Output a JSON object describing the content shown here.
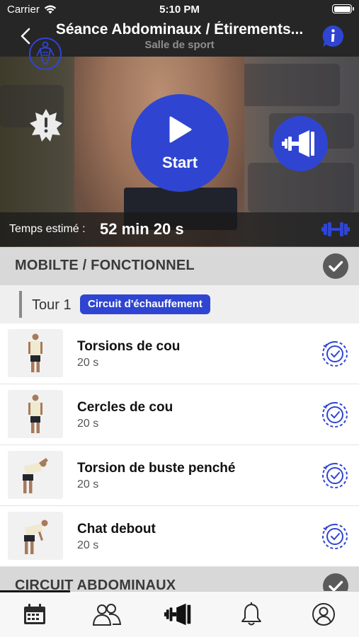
{
  "status_bar": {
    "carrier": "Carrier",
    "time": "5:10 PM"
  },
  "nav": {
    "title": "Séance Abdominaux / Étirements...",
    "subtitle": "Salle de sport"
  },
  "hero": {
    "start_label": "Start",
    "time_label": "Temps estimé :",
    "time_value": "52 min 20 s"
  },
  "sections": [
    {
      "title": "MOBILTE / FONCTIONNEL"
    },
    {
      "title": "CIRCUIT ABDOMINAUX"
    }
  ],
  "round": {
    "label": "Tour 1",
    "badge": "Circuit d'échauffement"
  },
  "exercises": [
    {
      "name": "Torsions de cou",
      "duration": "20 s"
    },
    {
      "name": "Cercles de cou",
      "duration": "20 s"
    },
    {
      "name": "Torsion de buste penché",
      "duration": "20 s"
    },
    {
      "name": "Chat debout",
      "duration": "20 s"
    }
  ],
  "tabs": [
    {
      "icon": "calendar-icon"
    },
    {
      "icon": "community-icon"
    },
    {
      "icon": "workout-icon"
    },
    {
      "icon": "bell-icon"
    },
    {
      "icon": "profile-icon"
    }
  ],
  "colors": {
    "accent": "#2f45d1",
    "dark_bar": "#262626",
    "section_bg": "#d8d8d8"
  }
}
